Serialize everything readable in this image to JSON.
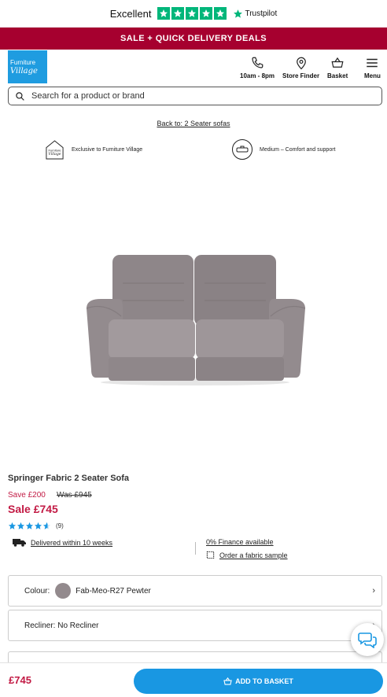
{
  "trustpilot": {
    "rating_word": "Excellent",
    "brand": "Trustpilot",
    "stars": 5
  },
  "promo": {
    "text": "SALE + QUICK DELIVERY DEALS"
  },
  "header": {
    "logo_line1": "Furniture",
    "logo_line2": "Village",
    "nav": [
      {
        "label": "10am - 8pm",
        "icon": "phone-icon"
      },
      {
        "label": "Store Finder",
        "icon": "location-pin-icon"
      },
      {
        "label": "Basket",
        "icon": "basket-icon"
      },
      {
        "label": "Menu",
        "icon": "hamburger-menu-icon"
      }
    ]
  },
  "search": {
    "placeholder": "Search for a product or brand"
  },
  "breadcrumb": {
    "back_link": "Back to: 2 Seater sofas"
  },
  "features": [
    {
      "label": "Exclusive to Furniture Village",
      "icon_text_1": "Furniture",
      "icon_text_2": "Village"
    },
    {
      "label": "Medium – Comfort and support"
    }
  ],
  "product": {
    "name": "Springer Fabric 2 Seater Sofa",
    "save": "Save £200",
    "was": "Was £945",
    "sale_price": "Sale £745",
    "rating_stars": 4.5,
    "review_count": "(9)"
  },
  "info": {
    "delivery": "Delivered within 10 weeks",
    "finance": "0% Finance available",
    "sample": "Order a fabric sample"
  },
  "options": {
    "colour_label": "Colour:",
    "colour_value": "Fab-Meo-R27 Pewter",
    "colour_swatch": "#938a8d",
    "recliner": "Recliner: No Recliner"
  },
  "bottom_bar": {
    "price": "£745",
    "add_to_basket": "ADD TO BASKET"
  },
  "colors": {
    "brand_blue": "#1997e2",
    "promo_red": "#a6002f",
    "sale_red": "#c21a44",
    "trustpilot_green": "#00b67a"
  }
}
